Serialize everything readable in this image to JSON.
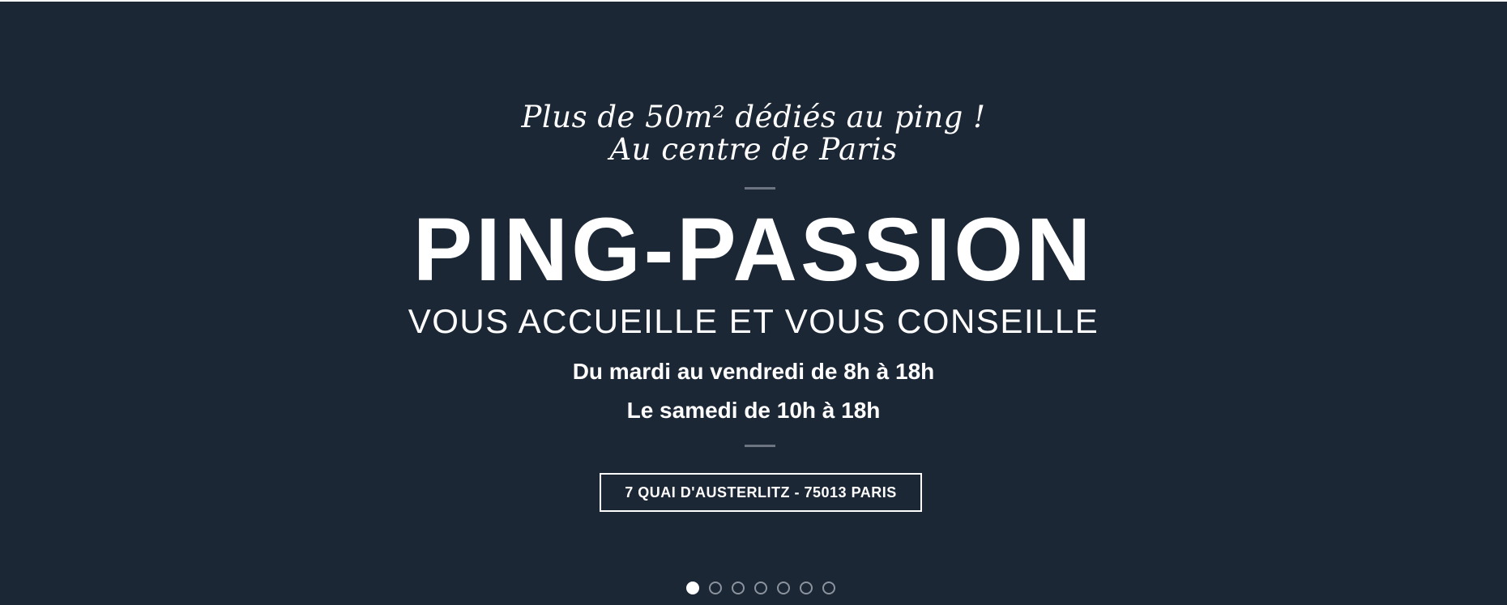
{
  "hero": {
    "tagline_line1": "Plus de 50m² dédiés au ping !",
    "tagline_line2": "Au centre de Paris",
    "title": "PING-PASSION",
    "subtitle": "VOUS ACCUEILLE ET VOUS CONSEILLE",
    "hours_line1": "Du mardi au vendredi de 8h à 18h",
    "hours_line2": "Le samedi de 10h à 18h",
    "address_button": "7 QUAI D'AUSTERLITZ - 75013 PARIS"
  },
  "carousel": {
    "slide_count": 7,
    "active_index": 0
  },
  "colors": {
    "background": "#1c2736",
    "text": "#ffffff",
    "divider": "#6b7480",
    "dot_inactive": "#8a939e"
  }
}
